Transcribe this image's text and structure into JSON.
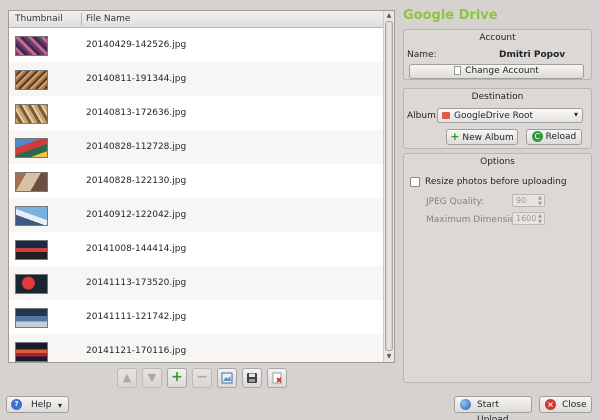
{
  "file_list": {
    "columns": [
      "Thumbnail",
      "File Name"
    ],
    "files": [
      "20140429-142526.jpg",
      "20140811-191344.jpg",
      "20140813-172636.jpg",
      "20140828-112728.jpg",
      "20140828-122130.jpg",
      "20140912-122042.jpg",
      "20141008-144414.jpg",
      "20141113-173520.jpg",
      "20141111-121742.jpg",
      "20141121-170116.jpg"
    ]
  },
  "toolbar": {
    "buttons": [
      "move-up",
      "move-down",
      "add",
      "remove",
      "image-edit",
      "save",
      "clear"
    ]
  },
  "service_title": "Google Drive",
  "account": {
    "group_title": "Account",
    "name_label": "Name:",
    "name_value": "Dmitri Popov",
    "change_button": "Change Account"
  },
  "destination": {
    "group_title": "Destination",
    "album_label": "Album:",
    "album_value": "GoogleDrive Root",
    "new_album_button": "New Album",
    "reload_button": "Reload"
  },
  "options": {
    "group_title": "Options",
    "resize_label": "Resize photos before uploading",
    "resize_checked": false,
    "jpeg_quality_label": "JPEG Quality:",
    "jpeg_quality_value": "90",
    "max_dimension_label": "Maximum Dimension:",
    "max_dimension_value": "1600"
  },
  "footer": {
    "help_button": "Help",
    "start_upload_button": "Start Upload",
    "close_button": "Close"
  },
  "colors": {
    "title_green": "#8cc43f",
    "background": "#d6d2d0"
  }
}
